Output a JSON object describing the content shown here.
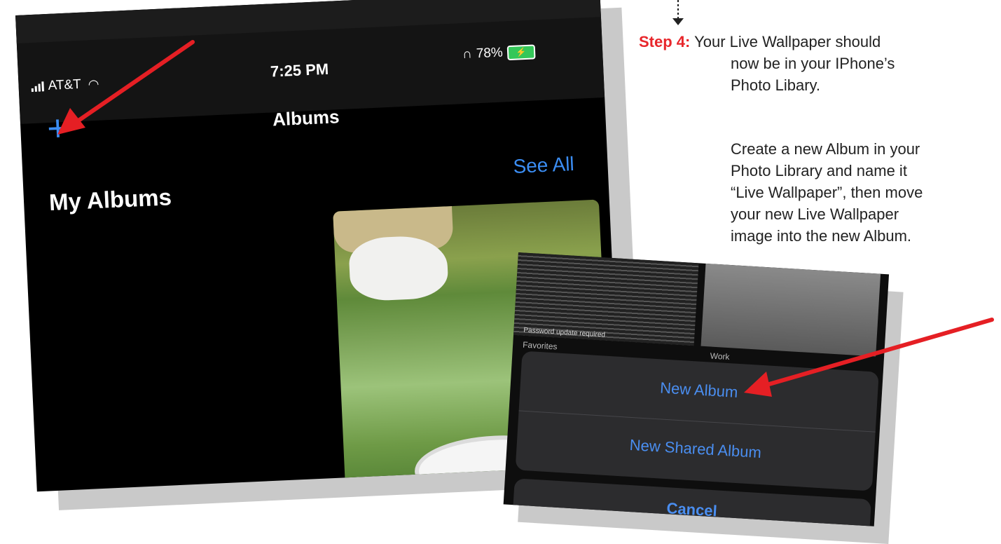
{
  "status_bar": {
    "carrier": "AT&T",
    "time": "7:25 PM",
    "battery": "78%"
  },
  "albums_screen": {
    "title": "Albums",
    "section_title": "My Albums",
    "see_all": "See All",
    "add_icon": "plus-icon"
  },
  "action_sheet": {
    "new_album": "New Album",
    "new_shared_album": "New Shared Album",
    "cancel": "Cancel",
    "favorites_label": "Favorites",
    "work_label": "Work",
    "password_note": "Password update required"
  },
  "instructions": {
    "step_label": "Step 4:",
    "line1": "Your Live Wallpaper should",
    "line2": "now be in your IPhone’s",
    "line3": "Photo Libary.",
    "p2_line1": "Create a new Album in your",
    "p2_line2": "Photo Library and name it",
    "p2_line3": "“Live Wallpaper”, then move",
    "p2_line4": "your new Live Wallpaper",
    "p2_line5": "image into the new Album."
  },
  "colors": {
    "ios_blue": "#3b8df3",
    "step_red": "#e8262b",
    "arrow_red": "#e51f24"
  }
}
